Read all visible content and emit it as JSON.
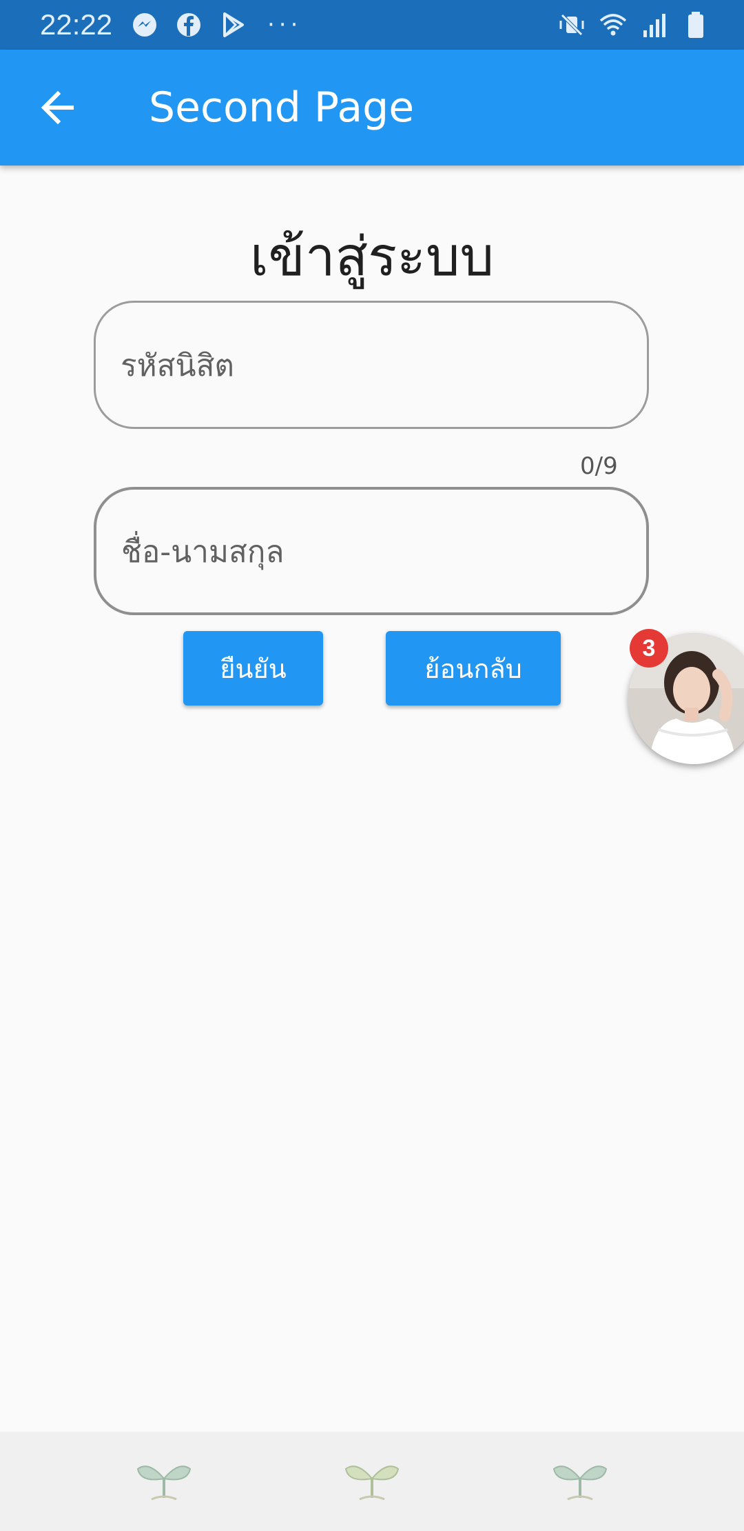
{
  "status_bar": {
    "time": "22:22",
    "left_icons": [
      "messenger-icon",
      "facebook-icon",
      "play-store-icon"
    ],
    "overflow": "···",
    "right_icons": [
      "mute-vibrate-icon",
      "wifi-icon",
      "signal-icon",
      "battery-icon"
    ],
    "color": "#1b6fba"
  },
  "app_bar": {
    "title": "Second Page",
    "color": "#2196f3"
  },
  "main": {
    "heading": "เข้าสู่ระบบ",
    "student_id_field": {
      "placeholder": "รหัสนิสิต",
      "value": "",
      "counter": "0/9"
    },
    "name_field": {
      "placeholder": "ชื่อ-นามสกุล",
      "value": ""
    },
    "confirm_button": "ยืนยัน",
    "back_button": "ย้อนกลับ"
  },
  "chat_head": {
    "badge_count": "3",
    "icon": "avatar"
  },
  "bottom_bar": {
    "icons": [
      "sprout-icon",
      "sprout-icon",
      "sprout-icon"
    ]
  }
}
